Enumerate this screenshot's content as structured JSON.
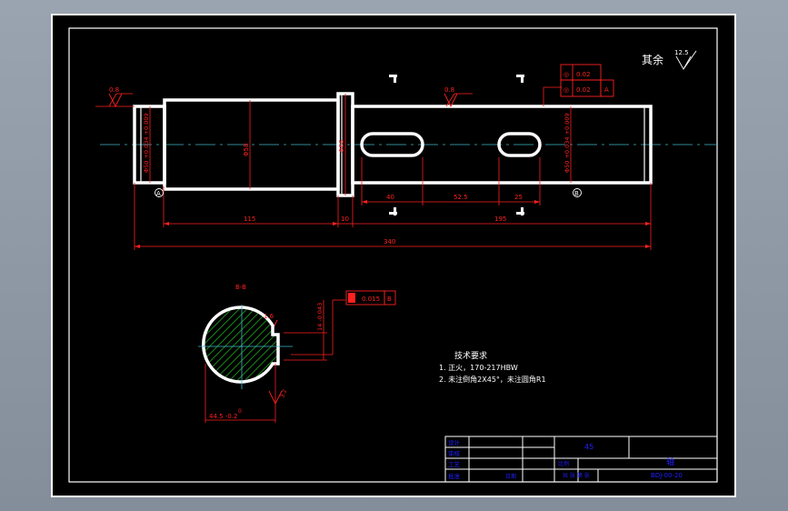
{
  "roughness": {
    "other": "其余",
    "other_value": "12.5"
  },
  "surface_finish": {
    "left": "0.8",
    "middle": "0.8",
    "section": "1.6",
    "section_small": "3.2"
  },
  "tolerance_frame_main": {
    "symbol_a": "◎",
    "value_a": "0.02",
    "symbol_b": "◎",
    "value_b": "0.02",
    "datum": "A"
  },
  "tolerance_frame_section": {
    "value": "0.015",
    "datum": "B"
  },
  "diameters": {
    "left": "Φ50 +0.034 +0.009",
    "main": "Φ58",
    "collar": "Φ66",
    "right": "Φ50 +0.034 +0.009"
  },
  "datum_left": "A",
  "datum_right": "B",
  "dimensions": {
    "d115": "115",
    "d10": "10",
    "d195": "195",
    "d340": "340",
    "d40": "40",
    "d52_5": "52.5",
    "d25": "25"
  },
  "section": {
    "label": "B-B",
    "key_width": "14 -0.043",
    "depth": "44.5 -0.2",
    "depth_top": "0"
  },
  "requirements": {
    "title": "技术要求",
    "line1": "1. 正火，170-217HBW",
    "line2": "2. 未注倒角2X45°，未注圆角R1"
  },
  "title_block": {
    "row_labels": [
      "设计",
      "审核",
      "工艺",
      "批准"
    ],
    "material": "45",
    "part_name": "轴",
    "drawing_no": "BDJ-00-20",
    "scale_label": "比例",
    "sheet": "共 张 第 张",
    "date_label": "日期"
  }
}
